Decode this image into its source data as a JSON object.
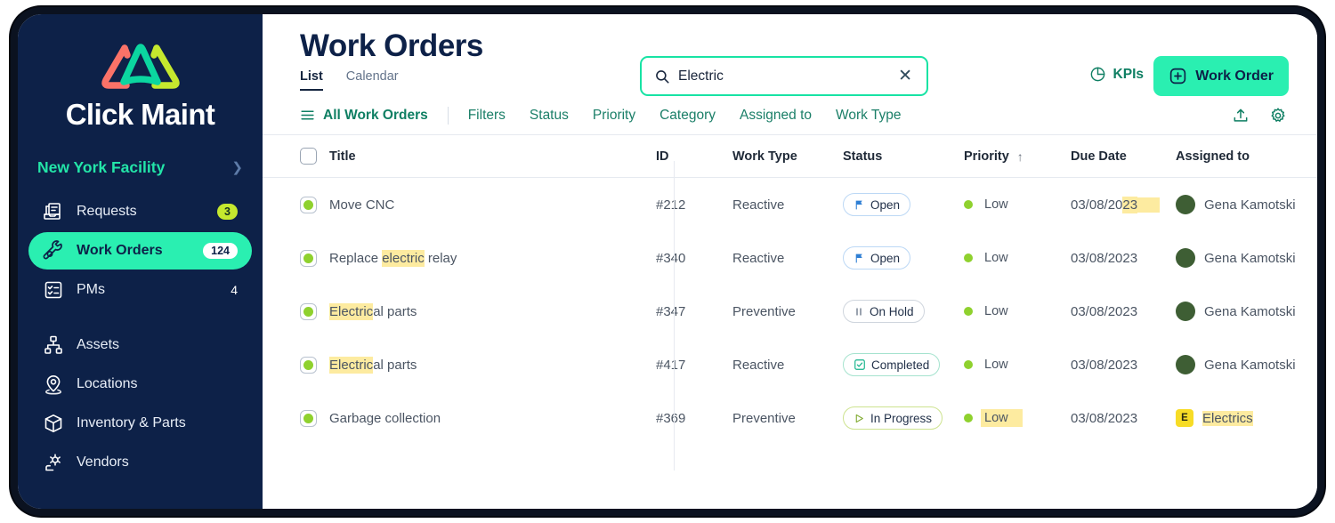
{
  "sidebar": {
    "brand": "Click Maint",
    "facility": "New York Facility",
    "items": [
      {
        "label": "Requests",
        "icon": "requests-icon",
        "count": "3",
        "count_style": "lime",
        "active": false
      },
      {
        "label": "Work Orders",
        "icon": "wrench-icon",
        "count": "124",
        "count_style": "pill",
        "active": true
      },
      {
        "label": "PMs",
        "icon": "checklist-icon",
        "count": "4",
        "count_style": "plain",
        "active": false
      },
      {
        "label": "Assets",
        "icon": "assets-icon",
        "count": "",
        "count_style": "none",
        "active": false
      },
      {
        "label": "Locations",
        "icon": "location-pin-icon",
        "count": "",
        "count_style": "none",
        "active": false
      },
      {
        "label": "Inventory & Parts",
        "icon": "box-icon",
        "count": "",
        "count_style": "none",
        "active": false
      },
      {
        "label": "Vendors",
        "icon": "vendors-icon",
        "count": "",
        "count_style": "none",
        "active": false
      }
    ]
  },
  "header": {
    "title": "Work Orders",
    "tabs": [
      {
        "label": "List",
        "active": true
      },
      {
        "label": "Calendar",
        "active": false
      }
    ],
    "search": {
      "value": "Electric",
      "placeholder": "Search",
      "icon": "search-icon",
      "clear_icon": "close-icon"
    },
    "kpis_label": "KPIs",
    "kpis_icon": "pie-chart-icon",
    "new_work_order_label": "Work Order",
    "new_work_order_icon": "plus-square-icon"
  },
  "filterbar": {
    "all_label": "All Work Orders",
    "all_icon": "hamburger-icon",
    "links": [
      "Filters",
      "Status",
      "Priority",
      "Category",
      "Assigned to",
      "Work Type"
    ],
    "export_icon": "upload-icon",
    "settings_icon": "gear-icon"
  },
  "table": {
    "columns": [
      {
        "key": "title",
        "label": "Title",
        "sort": ""
      },
      {
        "key": "id",
        "label": "ID",
        "sort": ""
      },
      {
        "key": "type",
        "label": "Work Type",
        "sort": ""
      },
      {
        "key": "status",
        "label": "Status",
        "sort": ""
      },
      {
        "key": "priority",
        "label": "Priority",
        "sort": "↑"
      },
      {
        "key": "due",
        "label": "Due Date",
        "sort": ""
      },
      {
        "key": "assignee",
        "label": "Assigned to",
        "sort": ""
      }
    ],
    "rows": [
      {
        "title_pre": "Move CNC",
        "title_hl": "",
        "title_post": "",
        "id": "#212",
        "type": "Reactive",
        "status": "Open",
        "status_kind": "open",
        "status_icon": "flag-icon",
        "priority": "Low",
        "priority_hl": false,
        "due_pre": "03/08/20",
        "due_hl": "23",
        "due_tail_hl": true,
        "assignee": "Gena Kamotski",
        "assignee_hl": false,
        "avatar_kind": "photo",
        "avatar_letter": ""
      },
      {
        "title_pre": "Replace ",
        "title_hl": "electric",
        "title_post": " relay",
        "id": "#340",
        "type": "Reactive",
        "status": "Open",
        "status_kind": "open",
        "status_icon": "flag-icon",
        "priority": "Low",
        "priority_hl": false,
        "due_pre": "03/08/2023",
        "due_hl": "",
        "due_tail_hl": false,
        "assignee": "Gena Kamotski",
        "assignee_hl": false,
        "avatar_kind": "photo",
        "avatar_letter": ""
      },
      {
        "title_pre": "",
        "title_hl": "Electric",
        "title_post": "al parts",
        "id": "#347",
        "type": "Preventive",
        "status": "On Hold",
        "status_kind": "onhold",
        "status_icon": "pause-icon",
        "priority": "Low",
        "priority_hl": false,
        "due_pre": "03/08/2023",
        "due_hl": "",
        "due_tail_hl": false,
        "assignee": "Gena Kamotski",
        "assignee_hl": false,
        "avatar_kind": "photo",
        "avatar_letter": ""
      },
      {
        "title_pre": "",
        "title_hl": "Electric",
        "title_post": "al parts",
        "id": "#417",
        "type": "Reactive",
        "status": "Completed",
        "status_kind": "completed",
        "status_icon": "check-square-icon",
        "priority": "Low",
        "priority_hl": false,
        "due_pre": "03/08/2023",
        "due_hl": "",
        "due_tail_hl": false,
        "assignee": "Gena Kamotski",
        "assignee_hl": false,
        "avatar_kind": "photo",
        "avatar_letter": ""
      },
      {
        "title_pre": "Garbage collection",
        "title_hl": "",
        "title_post": "",
        "id": "#369",
        "type": "Preventive",
        "status": "In Progress",
        "status_kind": "inprogress",
        "status_icon": "play-icon",
        "priority": "Low",
        "priority_hl": true,
        "due_pre": "03/08/2023",
        "due_hl": "",
        "due_tail_hl": false,
        "assignee": "Electrics",
        "assignee_hl": true,
        "avatar_kind": "letter",
        "avatar_letter": "E"
      }
    ]
  },
  "colors": {
    "sidebar_bg": "#0d2148",
    "accent_teal": "#2aefb1",
    "accent_lime": "#c5e82e",
    "highlight_yellow": "#fdeba0",
    "link_green": "#1b7f68",
    "priority_green": "#8fd12e"
  }
}
